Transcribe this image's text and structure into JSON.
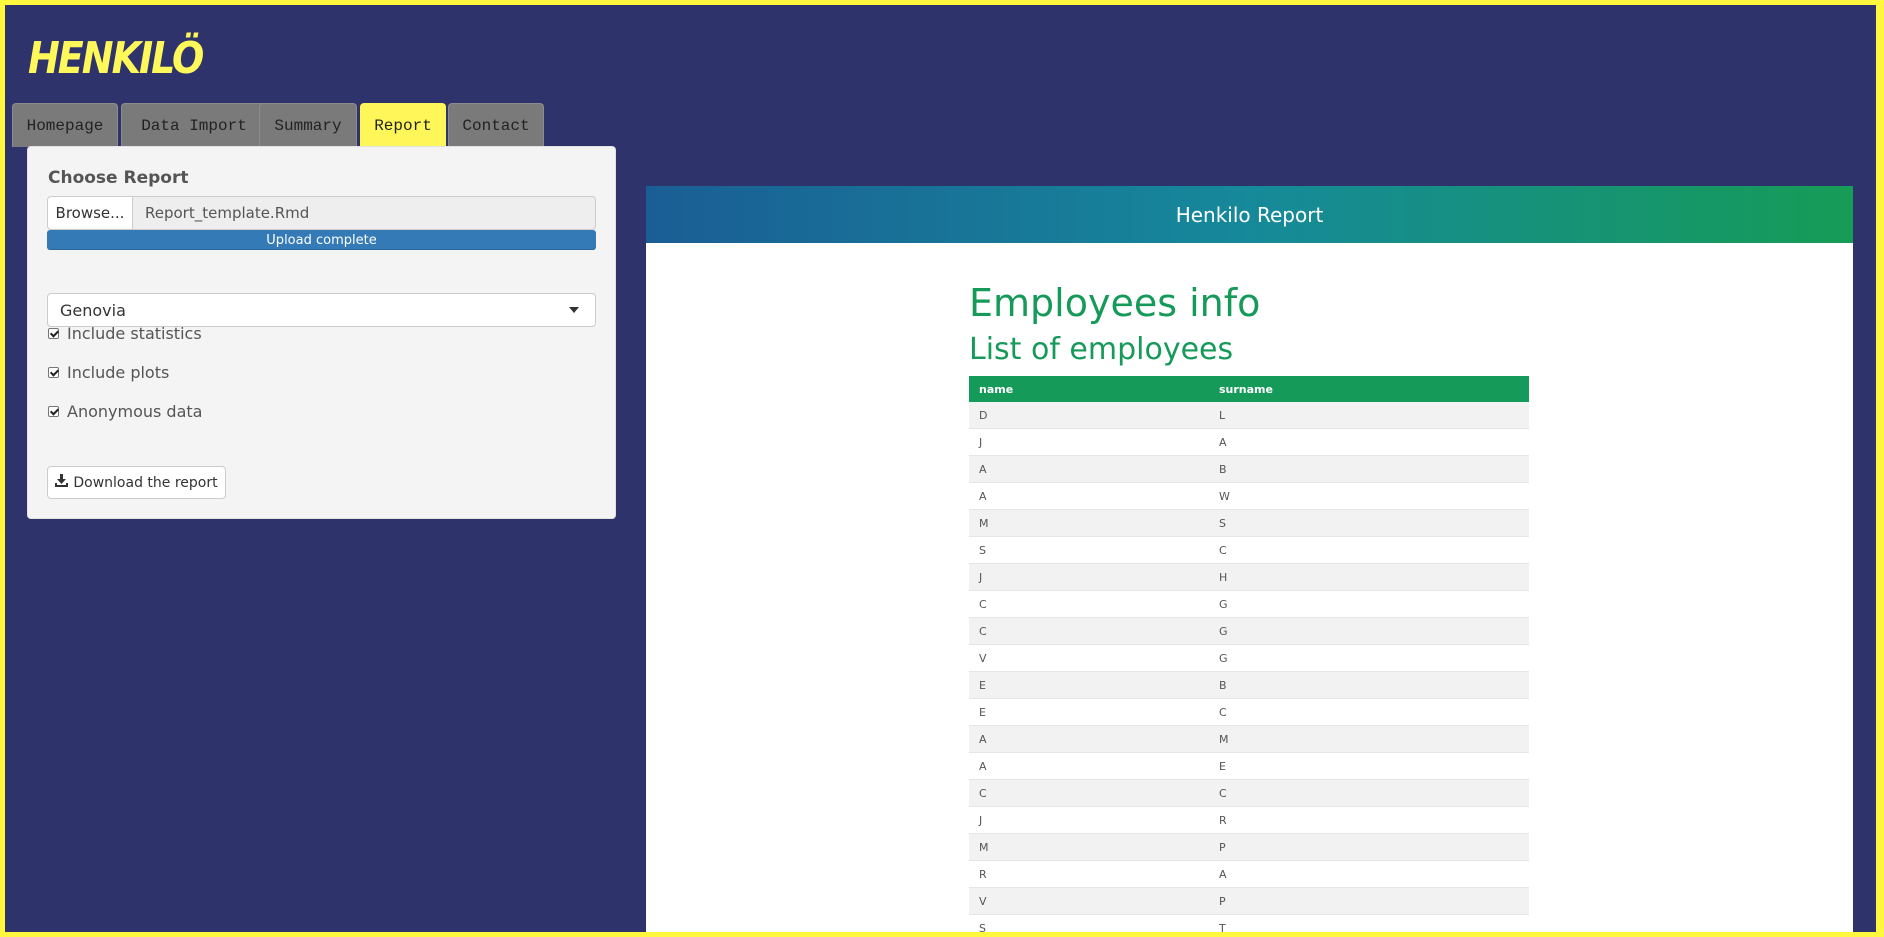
{
  "brand": "HENKILÖ",
  "colors": {
    "background": "#2e336b",
    "frame": "#fff83f",
    "accent": "#fff75a",
    "report_green": "#169a5a",
    "progress_blue": "#337ab7"
  },
  "tabs": [
    "Homepage",
    "Data Import",
    "Summary",
    "Report",
    "Contact"
  ],
  "active_tab": "Report",
  "sidebar": {
    "title": "Choose Report",
    "browse_label": "Browse...",
    "file_name": "Report_template.Rmd",
    "progress_label": "Upload complete",
    "progress_value": 1.0,
    "country_select": "Genovia",
    "checkboxes": [
      {
        "label": "Include statistics",
        "checked": true
      },
      {
        "label": "Include plots",
        "checked": true
      },
      {
        "label": "Anonymous data",
        "checked": true
      }
    ],
    "download_label": "Download the report",
    "download_icon": "download-icon"
  },
  "report": {
    "header": "Henkilo Report",
    "h1": "Employees info",
    "h2": "List of employees",
    "columns": [
      "name",
      "surname"
    ],
    "rows": [
      [
        "D",
        "L"
      ],
      [
        "J",
        "A"
      ],
      [
        "A",
        "B"
      ],
      [
        "A",
        "W"
      ],
      [
        "M",
        "S"
      ],
      [
        "S",
        "C"
      ],
      [
        "J",
        "H"
      ],
      [
        "C",
        "G"
      ],
      [
        "C",
        "G"
      ],
      [
        "V",
        "G"
      ],
      [
        "E",
        "B"
      ],
      [
        "E",
        "C"
      ],
      [
        "A",
        "M"
      ],
      [
        "A",
        "E"
      ],
      [
        "C",
        "C"
      ],
      [
        "J",
        "R"
      ],
      [
        "M",
        "P"
      ],
      [
        "R",
        "A"
      ],
      [
        "V",
        "P"
      ],
      [
        "S",
        "T"
      ]
    ]
  }
}
